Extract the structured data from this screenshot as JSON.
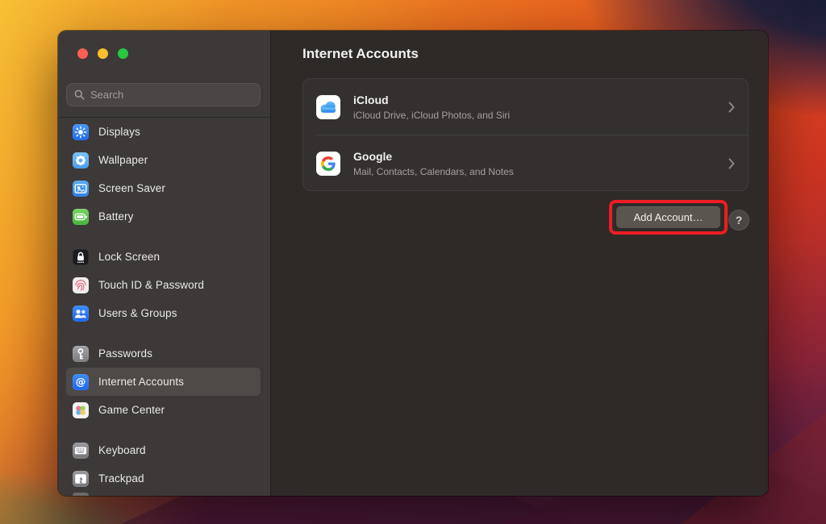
{
  "window": {
    "traffic_lights": {
      "close": "close",
      "minimize": "minimize",
      "zoom": "zoom"
    }
  },
  "sidebar": {
    "search_placeholder": "Search",
    "groups": [
      {
        "items": [
          {
            "label": "Displays"
          },
          {
            "label": "Wallpaper"
          },
          {
            "label": "Screen Saver"
          },
          {
            "label": "Battery"
          }
        ]
      },
      {
        "items": [
          {
            "label": "Lock Screen"
          },
          {
            "label": "Touch ID & Password"
          },
          {
            "label": "Users & Groups"
          }
        ]
      },
      {
        "items": [
          {
            "label": "Passwords"
          },
          {
            "label": "Internet Accounts",
            "selected": true
          },
          {
            "label": "Game Center"
          }
        ]
      },
      {
        "items": [
          {
            "label": "Keyboard"
          },
          {
            "label": "Trackpad"
          }
        ]
      }
    ]
  },
  "main": {
    "title": "Internet Accounts",
    "accounts": [
      {
        "name": "iCloud",
        "description": "iCloud Drive, iCloud Photos, and Siri"
      },
      {
        "name": "Google",
        "description": "Mail, Contacts, Calendars, and Notes"
      }
    ],
    "add_account_label": "Add Account…",
    "help_label": "?"
  },
  "colors": {
    "annotation_red": "#ee1d23",
    "sidebar_bg": "#3c3938",
    "main_bg": "#2d2a28",
    "card_bg": "#343030",
    "selected_item_bg": "#4e4a48",
    "accent_blue": "#2f7cf6",
    "traffic_red": "#ff5f57",
    "traffic_yellow": "#febc2e",
    "traffic_green": "#28c840"
  }
}
